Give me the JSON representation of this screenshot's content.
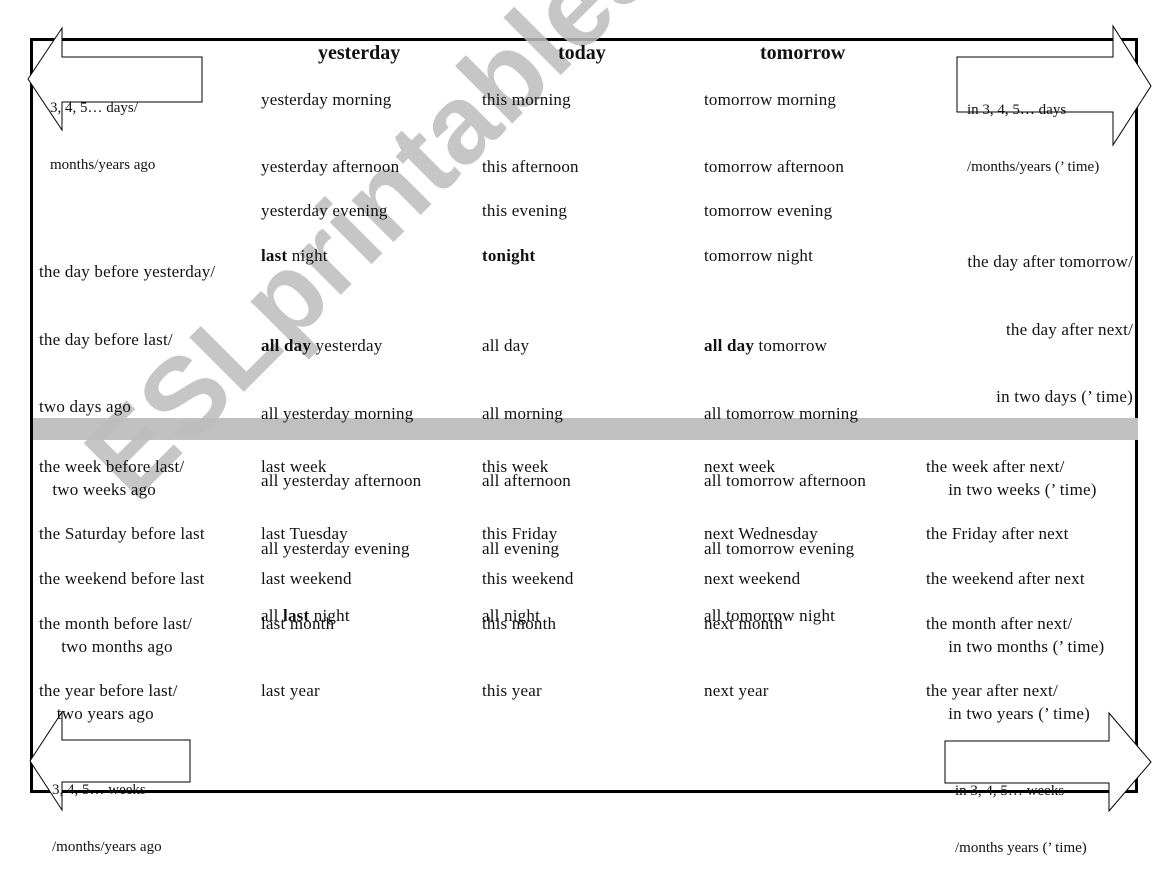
{
  "headers": {
    "yesterday": "yesterday",
    "today": "today",
    "tomorrow": "tomorrow"
  },
  "arrows": {
    "top_left": [
      "3, 4, 5… days/",
      "months/years ago"
    ],
    "top_right": [
      "in 3, 4, 5… days",
      "/months/years (’ time)"
    ],
    "bottom_left": [
      "3, 4, 5… weeks",
      "/months/years ago"
    ],
    "bottom_right": [
      "in 3, 4, 5… weeks",
      "/months years (’ time)"
    ]
  },
  "days_section": {
    "left": [
      "the day before yesterday/",
      "the day before last/",
      "two days ago"
    ],
    "right": [
      "the day after tomorrow/",
      "the day after next/",
      "in two days (’ time)"
    ],
    "yesterday": {
      "morning": "yesterday morning",
      "afternoon": "yesterday afternoon",
      "evening": "yesterday evening",
      "night_bold": "last",
      "night_rest": " night",
      "all_1_bold": "all day",
      "all_1_rest": " yesterday",
      "all_2": "all yesterday morning",
      "all_3": "all yesterday afternoon",
      "all_4": "all yesterday evening",
      "all_5_pre": "all ",
      "all_5_bold": "last",
      "all_5_rest": " night"
    },
    "today": {
      "morning": "this morning",
      "afternoon": "this afternoon",
      "evening": "this evening",
      "night_bold": "tonight",
      "all_1": "all day",
      "all_2": "all morning",
      "all_3": "all afternoon",
      "all_4": "all evening",
      "all_5": "all night"
    },
    "tomorrow": {
      "morning": "tomorrow morning",
      "afternoon": "tomorrow afternoon",
      "evening": "tomorrow evening",
      "night": "tomorrow night",
      "all_1_bold": "all day",
      "all_1_rest": " tomorrow",
      "all_2": "all tomorrow morning",
      "all_3": "all tomorrow afternoon",
      "all_4": "all tomorrow evening",
      "all_5": "all tomorrow night"
    }
  },
  "periods_section": {
    "rows": [
      {
        "before": [
          "the week before last/",
          "   two weeks ago"
        ],
        "last": "last week",
        "this": "this week",
        "next": "next week",
        "after": [
          "the week after next/",
          "     in two weeks (’ time)"
        ]
      },
      {
        "before": [
          "the Saturday before last"
        ],
        "last": "last Tuesday",
        "this": "this Friday",
        "next": "next Wednesday",
        "after": [
          "the Friday after next"
        ]
      },
      {
        "before": [
          "the weekend before last"
        ],
        "last": "last weekend",
        "this": "this weekend",
        "next": "next weekend",
        "after": [
          "the weekend after next"
        ]
      },
      {
        "before": [
          "the month before last/",
          "     two months ago"
        ],
        "last": "last month",
        "this": "this month",
        "next": "next month",
        "after": [
          "the month after next/",
          "     in two months (’ time)"
        ]
      },
      {
        "before": [
          "the year before last/",
          "    two years ago"
        ],
        "last": "last year",
        "this": "this year",
        "next": "next year",
        "after": [
          "the year after next/",
          "     in two years (’ time)"
        ]
      }
    ]
  },
  "watermark": "ESLprintables.com",
  "colors": {
    "band": "#c0c0c0",
    "watermark": "#bdbdbd",
    "border": "#000000"
  }
}
